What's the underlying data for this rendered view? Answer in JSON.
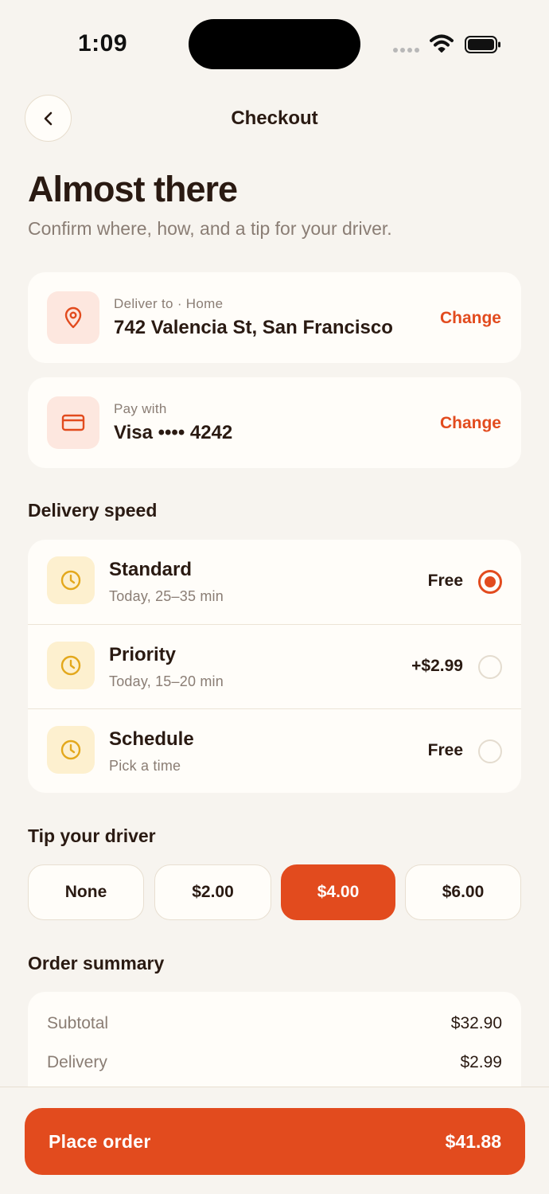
{
  "status_bar": {
    "time": "1:09"
  },
  "header": {
    "title": "Checkout",
    "back_icon": "chevron-left-icon"
  },
  "intro": {
    "headline": "Almost there",
    "subhead": "Confirm where, how, and a tip for your driver."
  },
  "delivery": {
    "label": "Deliver to · Home",
    "address": "742 Valencia St, San Francisco",
    "change_label": "Change",
    "icon": "location-pin-icon"
  },
  "payment": {
    "label": "Pay with",
    "method": "Visa •••• 4242",
    "change_label": "Change",
    "icon": "credit-card-icon"
  },
  "speed": {
    "title": "Delivery speed",
    "options": [
      {
        "name": "Standard",
        "eta": "Today, 25–35 min",
        "price": "Free",
        "selected": true
      },
      {
        "name": "Priority",
        "eta": "Today, 15–20 min",
        "price": "+$2.99",
        "selected": false
      },
      {
        "name": "Schedule",
        "eta": "Pick a time",
        "price": "Free",
        "selected": false
      }
    ]
  },
  "tip": {
    "title": "Tip your driver",
    "options": [
      "None",
      "$2.00",
      "$4.00",
      "$6.00"
    ],
    "selected_index": 2
  },
  "summary": {
    "title": "Order summary",
    "rows": [
      {
        "label": "Subtotal",
        "value": "$32.90"
      },
      {
        "label": "Delivery",
        "value": "$2.99"
      }
    ]
  },
  "cta": {
    "label": "Place order",
    "total": "$41.88"
  },
  "colors": {
    "accent": "#e24b1e",
    "background": "#f7f4ef",
    "card": "#fffdf9",
    "muted": "#8a7d74",
    "clock": "#e3a81c"
  }
}
